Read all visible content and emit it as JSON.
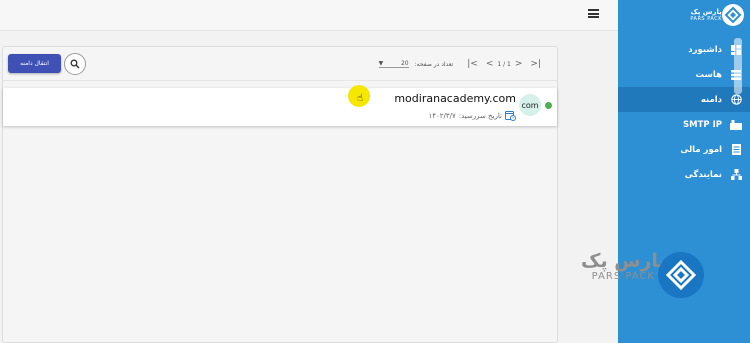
{
  "header": {
    "menu_icon": "hamburger-icon"
  },
  "toolbar": {
    "transfer_label": "انتقال دامنه",
    "search_icon": "search-icon",
    "pagination": {
      "rows_per_page_label": "تعداد در صفحه:",
      "rows_per_page_value": "20",
      "page_info": "1 / 1"
    }
  },
  "domains": [
    {
      "name": "modiranacademy.com",
      "tld": "com",
      "status_color": "#4caf50",
      "expiry_label": "تاریخ سررسید:",
      "expiry_date": "۱۴۰۲/۳/۷"
    }
  ],
  "sidebar": {
    "brand_fa": "پارس پک",
    "brand_en": "PARS PACK",
    "items": [
      {
        "label": "داشبورد",
        "icon": "dashboard-icon",
        "active": false
      },
      {
        "label": "هاست",
        "icon": "server-icon",
        "active": false
      },
      {
        "label": "دامنه",
        "icon": "globe-icon",
        "active": true
      },
      {
        "label": "SMTP IP",
        "icon": "mail-server-icon",
        "active": false
      },
      {
        "label": "امور مالی",
        "icon": "document-icon",
        "active": false
      },
      {
        "label": "نمایندگی",
        "icon": "agency-icon",
        "active": false
      }
    ],
    "accent": "#2d8fd4",
    "active_bg": "#1f79bb"
  },
  "watermark": {
    "fa": "پارس پک",
    "en": "PARS PACK"
  },
  "colors": {
    "primary_button": "#3f51b5"
  }
}
